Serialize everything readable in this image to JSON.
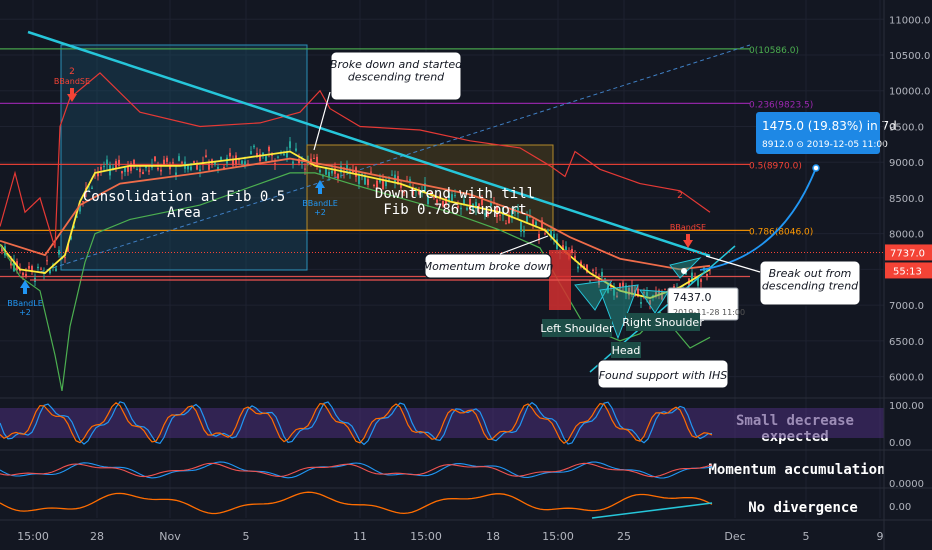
{
  "chart_data": {
    "type": "line",
    "title": "",
    "price_axis": {
      "ticks": [
        "11000.0",
        "10500.0",
        "10000.0",
        "9500.0",
        "9000.0",
        "8500.0",
        "8000.0",
        "7500.0",
        "7000.0",
        "6500.0",
        "6000.0"
      ],
      "values": [
        11000,
        10500,
        10000,
        9500,
        9000,
        8500,
        8000,
        7500,
        7000,
        6500,
        6000
      ],
      "ylim": [
        5700,
        11200
      ],
      "last_price": "7737.0",
      "countdown": "55:13",
      "scale": "linear"
    },
    "time_axis": {
      "ticks": [
        "15:00",
        "28",
        "Nov",
        "5",
        "11",
        "15:00",
        "18",
        "15:00",
        "25",
        "Dec",
        "5",
        "9"
      ]
    },
    "fib_levels": [
      {
        "label": "0(10586.0)",
        "value": 10586,
        "color": "#4caf50"
      },
      {
        "label": "0.236(9823.5)",
        "value": 9823.5,
        "color": "#9c27b0"
      },
      {
        "label": "0.5(8970.0)",
        "value": 8970,
        "color": "#f44336"
      },
      {
        "label": "0.786(8046.0)",
        "value": 8046,
        "color": "#ff9800"
      },
      {
        "label": "1",
        "value": 7400,
        "color": "#ef5350"
      }
    ],
    "series": [
      {
        "name": "",
        "color": "#ffeb3b",
        "points": [
          [
            0,
            7850
          ],
          [
            20,
            7500
          ],
          [
            45,
            7450
          ],
          [
            65,
            7700
          ],
          [
            80,
            8450
          ],
          [
            95,
            8850
          ],
          [
            130,
            8950
          ],
          [
            180,
            8950
          ],
          [
            240,
            9050
          ],
          [
            290,
            9150
          ],
          [
            315,
            8950
          ],
          [
            350,
            8850
          ],
          [
            400,
            8700
          ],
          [
            450,
            8450
          ],
          [
            500,
            8300
          ],
          [
            545,
            8050
          ],
          [
            565,
            7750
          ],
          [
            590,
            7450
          ],
          [
            620,
            7200
          ],
          [
            650,
            7100
          ],
          [
            680,
            7250
          ],
          [
            710,
            7500
          ]
        ]
      },
      {
        "name": "",
        "color": "#ef6c4a",
        "points": [
          [
            0,
            7900
          ],
          [
            45,
            7700
          ],
          [
            80,
            8400
          ],
          [
            120,
            8700
          ],
          [
            200,
            8850
          ],
          [
            290,
            9050
          ],
          [
            330,
            8950
          ],
          [
            400,
            8750
          ],
          [
            470,
            8550
          ],
          [
            530,
            8250
          ],
          [
            570,
            7950
          ],
          [
            620,
            7650
          ],
          [
            680,
            7500
          ],
          [
            710,
            7550
          ]
        ]
      },
      {
        "name": "",
        "color": "#4caf50",
        "points": [
          [
            0,
            7850
          ],
          [
            20,
            7400
          ],
          [
            40,
            7200
          ],
          [
            55,
            6300
          ],
          [
            62,
            5800
          ],
          [
            70,
            6700
          ],
          [
            85,
            7600
          ],
          [
            95,
            8000
          ],
          [
            130,
            8200
          ],
          [
            200,
            8400
          ],
          [
            290,
            8850
          ],
          [
            315,
            8850
          ],
          [
            350,
            8700
          ],
          [
            400,
            8500
          ],
          [
            450,
            8300
          ],
          [
            500,
            8050
          ],
          [
            540,
            7800
          ],
          [
            560,
            7300
          ],
          [
            585,
            6700
          ],
          [
            620,
            6500
          ],
          [
            640,
            6600
          ],
          [
            660,
            6900
          ],
          [
            690,
            6400
          ],
          [
            710,
            6550
          ]
        ]
      },
      {
        "name": "",
        "color": "#e53935",
        "points": [
          [
            0,
            8100
          ],
          [
            15,
            8850
          ],
          [
            25,
            8300
          ],
          [
            40,
            8500
          ],
          [
            55,
            7800
          ],
          [
            60,
            9500
          ],
          [
            70,
            9900
          ],
          [
            100,
            10250
          ],
          [
            140,
            9700
          ],
          [
            200,
            9500
          ],
          [
            260,
            9550
          ],
          [
            300,
            9700
          ],
          [
            320,
            10000
          ],
          [
            330,
            9750
          ],
          [
            360,
            9500
          ],
          [
            420,
            9450
          ],
          [
            470,
            9300
          ],
          [
            520,
            9200
          ],
          [
            550,
            8950
          ],
          [
            565,
            8800
          ],
          [
            575,
            9150
          ],
          [
            600,
            8900
          ],
          [
            640,
            8700
          ],
          [
            680,
            8600
          ],
          [
            710,
            8300
          ]
        ]
      }
    ],
    "annotations": [
      {
        "text": "Broke down and started\ndescending trend"
      },
      {
        "text": "Consolidation at Fib 0.5\nArea"
      },
      {
        "text": "Downtrend with till\nFib 0.786 support"
      },
      {
        "text": "Momentum broke down"
      },
      {
        "text": "Left Shoulder"
      },
      {
        "text": "Head"
      },
      {
        "text": "Right Shoulder"
      },
      {
        "text": "Found support with IHS"
      },
      {
        "text": "Break out from\ndescending trend"
      },
      {
        "text": "Small decrease\nexpected"
      },
      {
        "text": "Momentum accumulation"
      },
      {
        "text": "No divergence"
      }
    ],
    "signals": [
      {
        "text": "BBandLE\n+2"
      },
      {
        "text": "BBandSE"
      },
      {
        "text": "BBandLE\n+2"
      },
      {
        "text": "BBandSE"
      },
      {
        "text": "2"
      },
      {
        "text": "2"
      }
    ],
    "projection": {
      "line1": "1475.0 (19.83%) in 7d",
      "line2": "8912.0 ⊙ 2019-12-05  11:00"
    },
    "cursor_label": {
      "value": "7437.0",
      "date": "2019-11-28 11:00"
    },
    "oscillator_axis": {
      "stoch": [
        "100.00",
        "0.00"
      ],
      "macd": "0.0000",
      "ao": "0.00"
    }
  }
}
